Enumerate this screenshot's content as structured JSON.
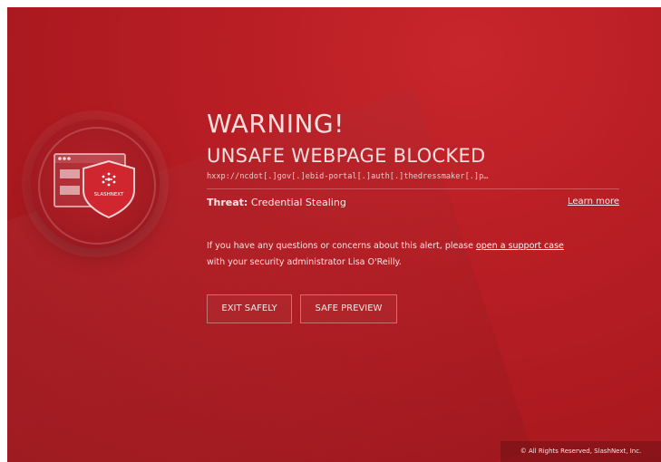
{
  "alert": {
    "title": "WARNING!",
    "subtitle": "UNSAFE WEBPAGE BLOCKED",
    "url": "hxxp://ncdot[.]gov[.]ebid-portal[.]auth[.]thedressmaker[.]p…",
    "threat_label": "Threat:",
    "threat_value": "Credential Stealing",
    "learn_more": "Learn more",
    "info_prefix": "If you have any questions or concerns about this alert, please ",
    "support_link": "open a support case",
    "info_suffix": "with your security administrator Lisa O'Reilly."
  },
  "buttons": {
    "exit_safely": "EXIT SAFELY",
    "safe_preview": "SAFE PREVIEW"
  },
  "emblem": {
    "brand_text": "SLASHNEXT",
    "icons": [
      "browser-window-icon",
      "shield-icon",
      "slashnext-logo-icon"
    ]
  },
  "footer": {
    "copyright": "© All Rights Reserved, SlashNext, Inc."
  },
  "colors": {
    "background": "#b71d24",
    "text": "#f6dede"
  }
}
